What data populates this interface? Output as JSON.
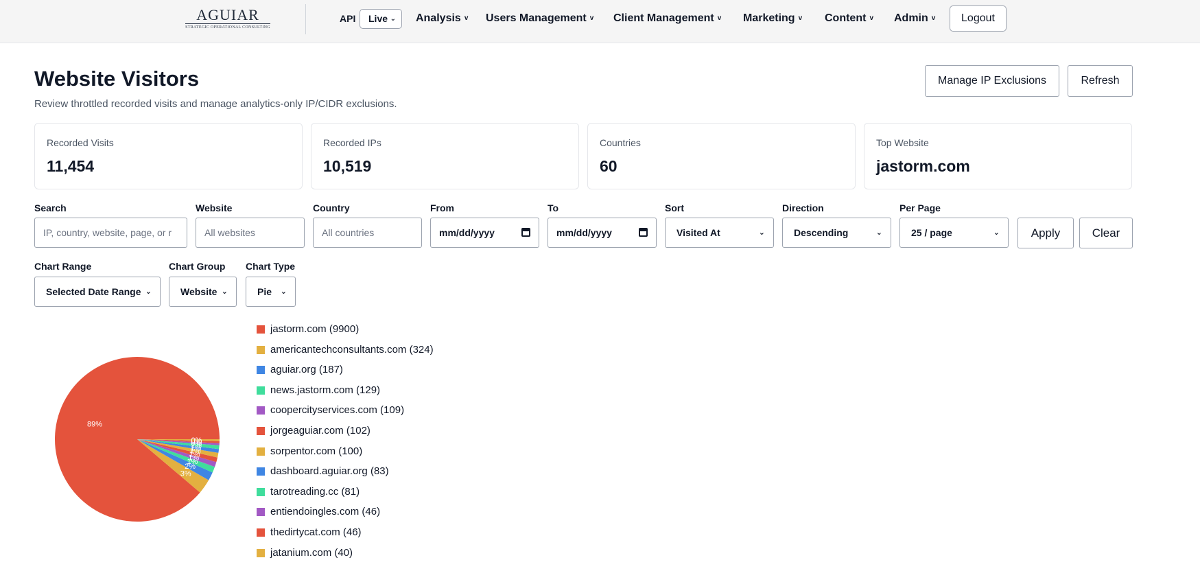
{
  "nav": {
    "logo_main": "AGUIAR",
    "logo_sub": "STRATEGIC OPERATIONAL CONSULTING",
    "api_label": "API",
    "api_value": "Live",
    "items": [
      {
        "label": "Analysis"
      },
      {
        "label": "Users Management"
      },
      {
        "label": "Client Management"
      },
      {
        "label": "Marketing"
      },
      {
        "label": "Content"
      },
      {
        "label": "Admin"
      }
    ],
    "caret": "v",
    "logout": "Logout"
  },
  "header": {
    "title": "Website Visitors",
    "subtitle": "Review throttled recorded visits and manage analytics-only IP/CIDR exclusions.",
    "manage_btn": "Manage IP Exclusions",
    "refresh_btn": "Refresh"
  },
  "stats": [
    {
      "label": "Recorded Visits",
      "value": "11,454"
    },
    {
      "label": "Recorded IPs",
      "value": "10,519"
    },
    {
      "label": "Countries",
      "value": "60"
    },
    {
      "label": "Top Website",
      "value": "jastorm.com"
    }
  ],
  "filters": {
    "search": {
      "label": "Search",
      "placeholder": "IP, country, website, page, or r"
    },
    "website": {
      "label": "Website",
      "placeholder": "All websites"
    },
    "country": {
      "label": "Country",
      "placeholder": "All countries"
    },
    "from": {
      "label": "From",
      "value": "mm/dd/yyyy"
    },
    "to": {
      "label": "To",
      "value": "mm/dd/yyyy"
    },
    "sort": {
      "label": "Sort",
      "value": "Visited At"
    },
    "direction": {
      "label": "Direction",
      "value": "Descending"
    },
    "per_page": {
      "label": "Per Page",
      "value": "25 / page"
    },
    "apply": "Apply",
    "clear": "Clear",
    "chart_range": {
      "label": "Chart Range",
      "value": "Selected Date Range"
    },
    "chart_group": {
      "label": "Chart Group",
      "value": "Website"
    },
    "chart_type": {
      "label": "Chart Type",
      "value": "Pie"
    }
  },
  "colors": {
    "palette": [
      "#e4533c",
      "#e3b040",
      "#3f86e3",
      "#3fdd9c",
      "#a259c4"
    ]
  },
  "chart_data": {
    "type": "pie",
    "slices": [
      {
        "label": "jastorm.com (9900)",
        "name": "jastorm.com",
        "value": 9900
      },
      {
        "label": "americantechconsultants.com (324)",
        "name": "americantechconsultants.com",
        "value": 324
      },
      {
        "label": "aguiar.org (187)",
        "name": "aguiar.org",
        "value": 187
      },
      {
        "label": "news.jastorm.com (129)",
        "name": "news.jastorm.com",
        "value": 129
      },
      {
        "label": "coopercityservices.com (109)",
        "name": "coopercityservices.com",
        "value": 109
      },
      {
        "label": "jorgeaguiar.com (102)",
        "name": "jorgeaguiar.com",
        "value": 102
      },
      {
        "label": "sorpentor.com (100)",
        "name": "sorpentor.com",
        "value": 100
      },
      {
        "label": "dashboard.aguiar.org (83)",
        "name": "dashboard.aguiar.org",
        "value": 83
      },
      {
        "label": "tarotreading.cc (81)",
        "name": "tarotreading.cc",
        "value": 81
      },
      {
        "label": "entiendoingles.com (46)",
        "name": "entiendoingles.com",
        "value": 46
      },
      {
        "label": "thedirtycat.com (46)",
        "name": "thedirtycat.com",
        "value": 46
      },
      {
        "label": "jatanium.com (40)",
        "name": "jatanium.com",
        "value": 40
      }
    ],
    "slice_labels": [
      "89%",
      "3%",
      "2%",
      "1%",
      "1%",
      "1%",
      "1%",
      "1%",
      "1%",
      "0%",
      "0%",
      "0%"
    ]
  }
}
